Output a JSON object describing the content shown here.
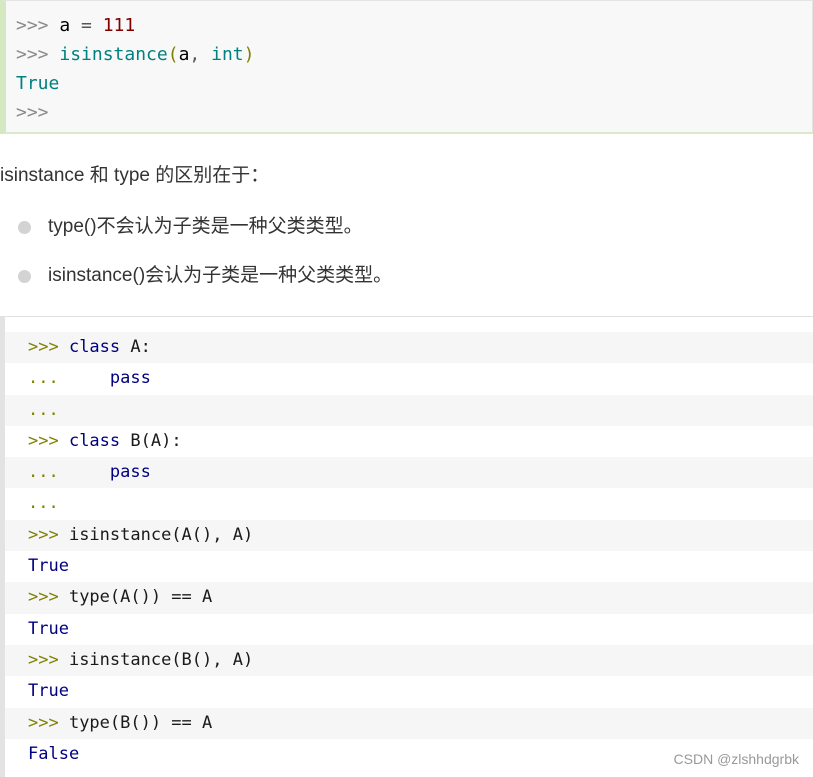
{
  "code_block_1": {
    "lines": [
      {
        "prompt": ">>> ",
        "var": "a",
        "op": " = ",
        "num": "111"
      },
      {
        "prompt": ">>> ",
        "func": "isinstance",
        "open": "(",
        "arg1": "a",
        "sep": ", ",
        "arg2": "int",
        "close": ")"
      },
      {
        "output": "True"
      },
      {
        "prompt": ">>>"
      }
    ]
  },
  "prose": {
    "intro": "isinstance 和 type 的区别在于：",
    "bullets": [
      "type()不会认为子类是一种父类类型。",
      "isinstance()会认为子类是一种父类类型。"
    ]
  },
  "code_block_2": {
    "lines": [
      {
        "prompt": ">>> ",
        "kw": "class",
        "rest": " A:"
      },
      {
        "prompt": "...     ",
        "kw": "pass"
      },
      {
        "prompt": "..."
      },
      {
        "prompt": ">>> ",
        "kw": "class",
        "rest": " B(A):"
      },
      {
        "prompt": "...     ",
        "kw": "pass"
      },
      {
        "prompt": "..."
      },
      {
        "prompt": ">>> ",
        "code": "isinstance(A(), A)"
      },
      {
        "output": "True"
      },
      {
        "prompt": ">>> ",
        "code": "type(A()) == A"
      },
      {
        "output": "True"
      },
      {
        "prompt": ">>> ",
        "code": "isinstance(B(), A)"
      },
      {
        "output": "True"
      },
      {
        "prompt": ">>> ",
        "code": "type(B()) == A"
      },
      {
        "output": "False"
      }
    ]
  },
  "watermark": "CSDN @zlshhdgrbk"
}
